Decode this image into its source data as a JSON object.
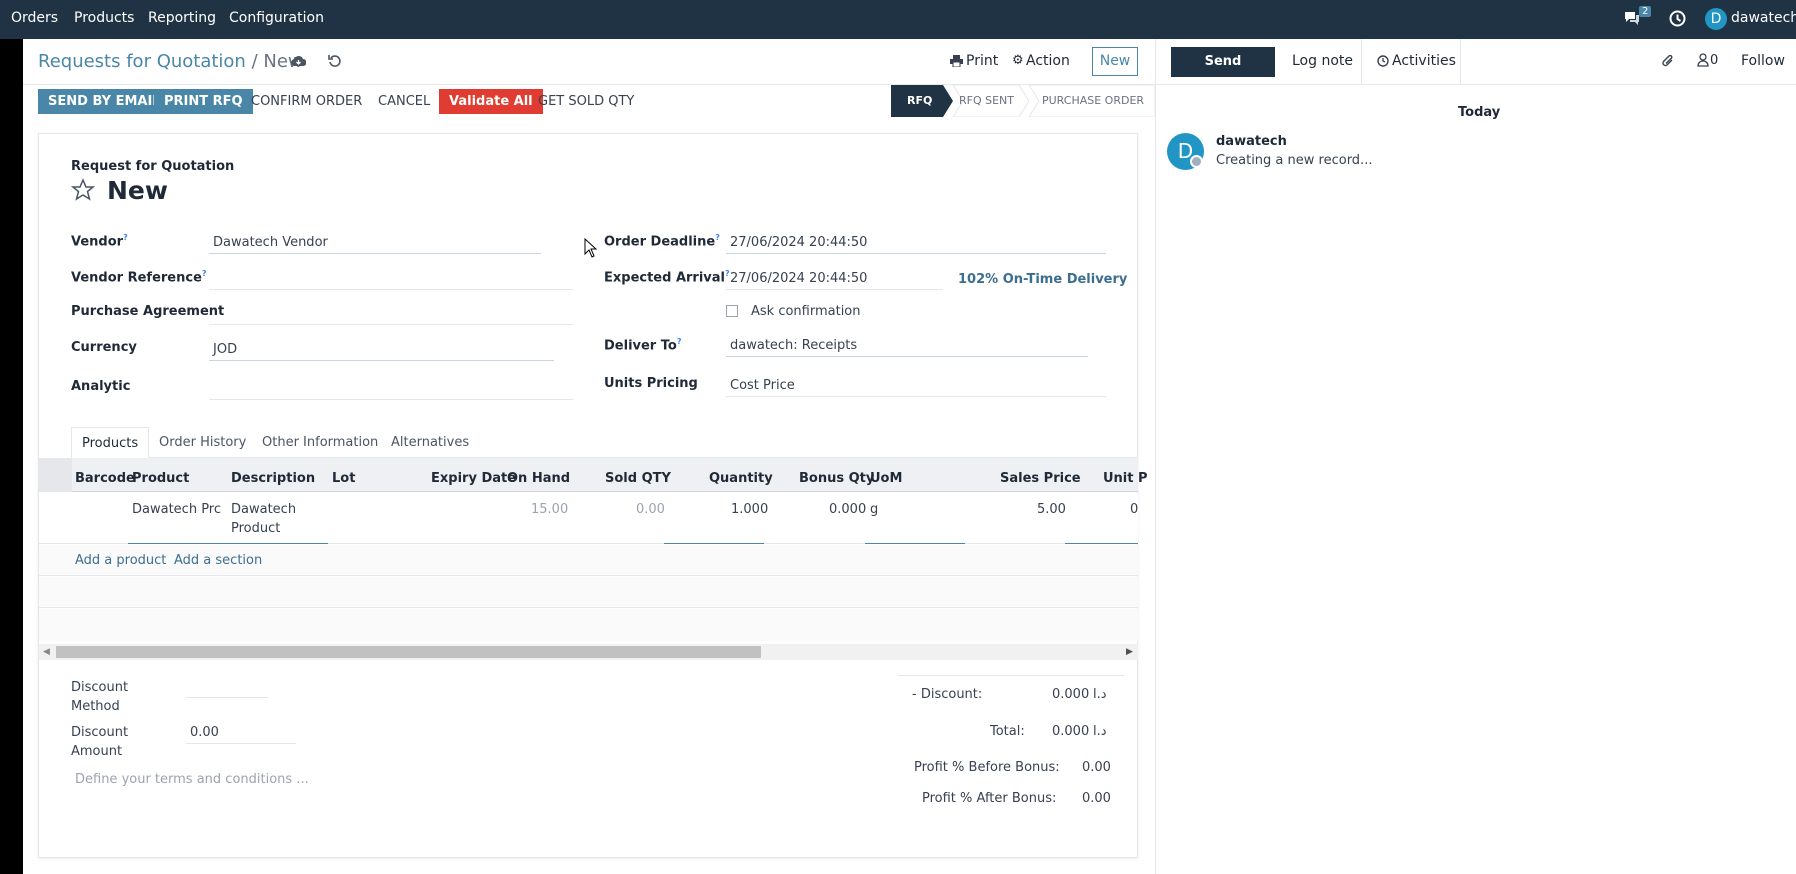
{
  "nav": {
    "menu": [
      "Orders",
      "Products",
      "Reporting",
      "Configuration"
    ],
    "messages_badge": "2",
    "user_initial": "D",
    "user_name": "dawatech"
  },
  "breadcrumb": {
    "parent": "Requests for Quotation",
    "separator": "/",
    "current": "New"
  },
  "toolbar": {
    "print": "Print",
    "action": "Action",
    "new": "New"
  },
  "buttons": {
    "send_email": "SEND BY EMAIL",
    "print_rfq": "PRINT RFQ",
    "confirm": "CONFIRM ORDER",
    "cancel": "CANCEL",
    "validate_all": "Validate All",
    "get_sold_qty": "GET SOLD QTY"
  },
  "statusbar": [
    "RFQ",
    "RFQ SENT",
    "PURCHASE ORDER"
  ],
  "form": {
    "doc_type": "Request for Quotation",
    "name": "New",
    "vendor_label": "Vendor",
    "vendor": "Dawatech Vendor",
    "vendor_ref_label": "Vendor Reference",
    "vendor_ref": "",
    "agreement_label": "Purchase Agreement",
    "agreement": "",
    "currency_label": "Currency",
    "currency": "JOD",
    "analytic_label": "Analytic",
    "analytic": "",
    "deadline_label": "Order Deadline",
    "deadline": "27/06/2024 20:44:50",
    "arrival_label": "Expected Arrival",
    "arrival": "27/06/2024 20:44:50",
    "on_time": "102% On-Time Delivery",
    "ask_confirmation": "Ask confirmation",
    "deliver_to_label": "Deliver To",
    "deliver_to": "dawatech: Receipts",
    "units_pricing_label": "Units Pricing",
    "units_pricing": "Cost Price",
    "help_mark": "?"
  },
  "tabs": [
    "Products",
    "Order History",
    "Other Information",
    "Alternatives"
  ],
  "lines": {
    "headers": [
      "Barcode",
      "Product",
      "Description",
      "Lot",
      "Expiry Date",
      "On Hand",
      "Sold QTY",
      "Quantity",
      "Bonus Qty",
      "UoM",
      "Sales Price",
      "Unit P"
    ],
    "row": {
      "product": "Dawatech Prc",
      "description_1": "Dawatech",
      "description_2": "Product",
      "on_hand": "15.00",
      "sold_qty": "0.00",
      "quantity": "1.000",
      "bonus_qty": "0.000",
      "uom": "g",
      "sales_price": "5.00",
      "unit_price": "0"
    },
    "add_product": "Add a product",
    "add_section": "Add a section"
  },
  "footer": {
    "discount_method_label_1": "Discount",
    "discount_method_label_2": "Method",
    "discount_amount_label_1": "Discount",
    "discount_amount_label_2": "Amount",
    "discount_amount": "0.00",
    "terms_placeholder": "Define your terms and conditions ...",
    "discount_label": "- Discount:",
    "discount_value": "0.000",
    "currency_symbol": "د.ا",
    "total_label": "Total:",
    "total_value": "0.000",
    "profit_before_label": "Profit % Before Bonus:",
    "profit_before": "0.00",
    "profit_after_label": "Profit % After Bonus:",
    "profit_after": "0.00"
  },
  "chatter": {
    "send_message": "Send message",
    "log_note": "Log note",
    "activities": "Activities",
    "followers": "0",
    "follow": "Follow",
    "today": "Today",
    "author": "dawatech",
    "author_initial": "D",
    "message": "Creating a new record..."
  },
  "colors": {
    "nav_bg": "#1f3344",
    "primary_btn": "#4a86a8",
    "danger_btn": "#e03c31",
    "status_active": "#1f3344",
    "link_blue": "#3b6e8f"
  }
}
